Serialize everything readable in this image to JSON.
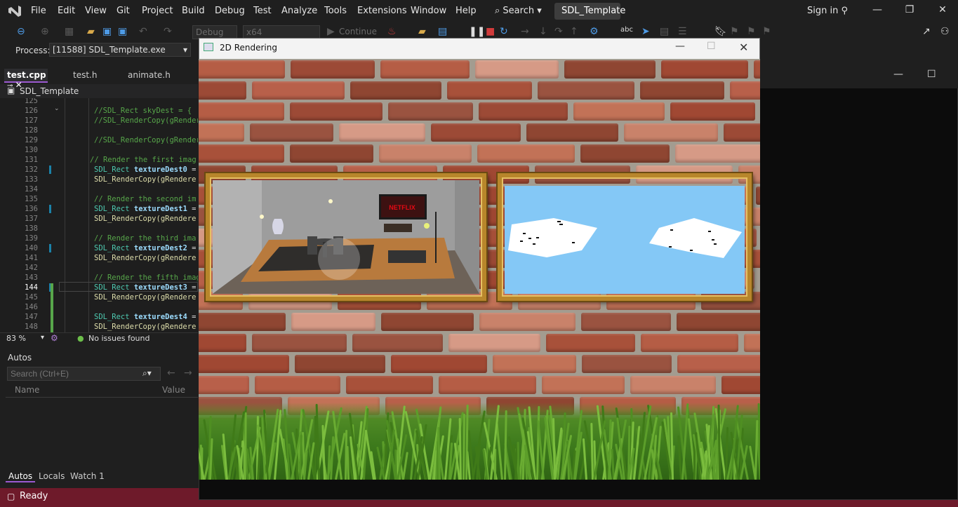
{
  "ide": {
    "menu": [
      "File",
      "Edit",
      "View",
      "Git",
      "Project",
      "Build",
      "Debug",
      "Test",
      "Analyze",
      "Tools",
      "Extensions",
      "Window",
      "Help"
    ],
    "search_label": "Search",
    "solution_name": "SDL_Template",
    "signin_label": "Sign in",
    "toolbar": {
      "config": "Debug",
      "platform": "x64",
      "continue_label": "Continue"
    },
    "process": {
      "label": "Process:",
      "value": "[11588] SDL_Template.exe"
    },
    "tabs": [
      {
        "label": "test.cpp",
        "active": true
      },
      {
        "label": "test.h",
        "active": false
      },
      {
        "label": "animate.h",
        "active": false
      }
    ],
    "nav_scope": "SDL_Template",
    "code_lines": [
      {
        "n": "125",
        "text": ""
      },
      {
        "n": "126",
        "text": "//SDL_Rect skyDest = {"
      },
      {
        "n": "127",
        "text": "//SDL_RenderCopy(gRender"
      },
      {
        "n": "128",
        "text": ""
      },
      {
        "n": "129",
        "text": "//SDL_RenderCopy(gRender"
      },
      {
        "n": "130",
        "text": ""
      },
      {
        "n": "131",
        "text": "// Render the first imag"
      },
      {
        "n": "132",
        "text": "SDL_Rect textureDest0 ="
      },
      {
        "n": "133",
        "text": "SDL_RenderCopy(gRendere"
      },
      {
        "n": "134",
        "text": ""
      },
      {
        "n": "135",
        "text": "// Render the second im"
      },
      {
        "n": "136",
        "text": "SDL_Rect textureDest1 ="
      },
      {
        "n": "137",
        "text": "SDL_RenderCopy(gRendere"
      },
      {
        "n": "138",
        "text": ""
      },
      {
        "n": "139",
        "text": "// Render the third ima"
      },
      {
        "n": "140",
        "text": "SDL_Rect textureDest2 ="
      },
      {
        "n": "141",
        "text": "SDL_RenderCopy(gRendere"
      },
      {
        "n": "142",
        "text": ""
      },
      {
        "n": "143",
        "text": "// Render the fifth imag"
      },
      {
        "n": "144",
        "text": "SDL_Rect textureDest3 ="
      },
      {
        "n": "145",
        "text": "SDL_RenderCopy(gRendere"
      },
      {
        "n": "146",
        "text": ""
      },
      {
        "n": "147",
        "text": "SDL_Rect textureDest4 ="
      },
      {
        "n": "148",
        "text": "SDL_RenderCopy(gRendere"
      }
    ],
    "zoom": "83 %",
    "issues": "No issues found",
    "autos": {
      "title": "Autos",
      "search_placeholder": "Search (Ctrl+E)",
      "col_name": "Name",
      "col_value": "Value"
    },
    "bottom_tabs": [
      "Autos",
      "Locals",
      "Watch 1"
    ],
    "status": "Ready",
    "accent_color": "#9b59d0",
    "status_bar_color": "#6e1a2a"
  },
  "sdl_window": {
    "title": "2D Rendering",
    "tv_text": "NETFLIX"
  }
}
